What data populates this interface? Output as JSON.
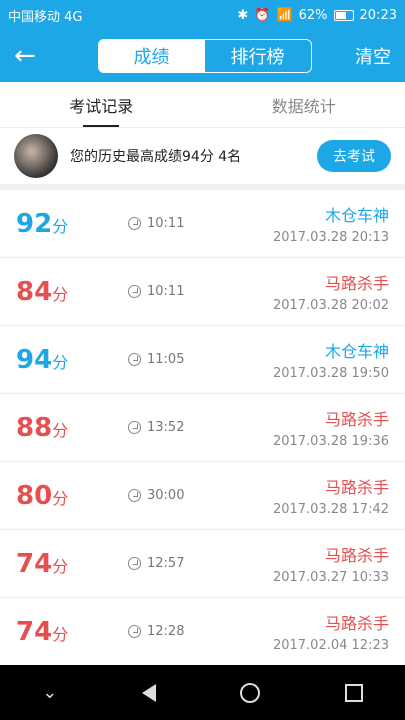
{
  "status": {
    "carrier": "中国移动 4G",
    "battery": "62%",
    "time": "20:23"
  },
  "header": {
    "back_icon": "arrow-left-icon",
    "segments": [
      "成绩",
      "排行榜"
    ],
    "clear": "清空"
  },
  "tabs": [
    "考试记录",
    "数据统计"
  ],
  "best": {
    "text": "您的历史最高成绩94分  4名",
    "button": "去考试"
  },
  "records": [
    {
      "score": "92",
      "unit": "分",
      "time": "10:11",
      "name": "木仓车神",
      "date": "2017.03.28  20:13",
      "color": "blue"
    },
    {
      "score": "84",
      "unit": "分",
      "time": "10:11",
      "name": "马路杀手",
      "date": "2017.03.28  20:02",
      "color": "red"
    },
    {
      "score": "94",
      "unit": "分",
      "time": "11:05",
      "name": "木仓车神",
      "date": "2017.03.28  19:50",
      "color": "blue"
    },
    {
      "score": "88",
      "unit": "分",
      "time": "13:52",
      "name": "马路杀手",
      "date": "2017.03.28  19:36",
      "color": "red"
    },
    {
      "score": "80",
      "unit": "分",
      "time": "30:00",
      "name": "马路杀手",
      "date": "2017.03.28  17:42",
      "color": "red"
    },
    {
      "score": "74",
      "unit": "分",
      "time": "12:57",
      "name": "马路杀手",
      "date": "2017.03.27  10:33",
      "color": "red"
    },
    {
      "score": "74",
      "unit": "分",
      "time": "12:28",
      "name": "马路杀手",
      "date": "2017.02.04  12:23",
      "color": "red"
    }
  ]
}
